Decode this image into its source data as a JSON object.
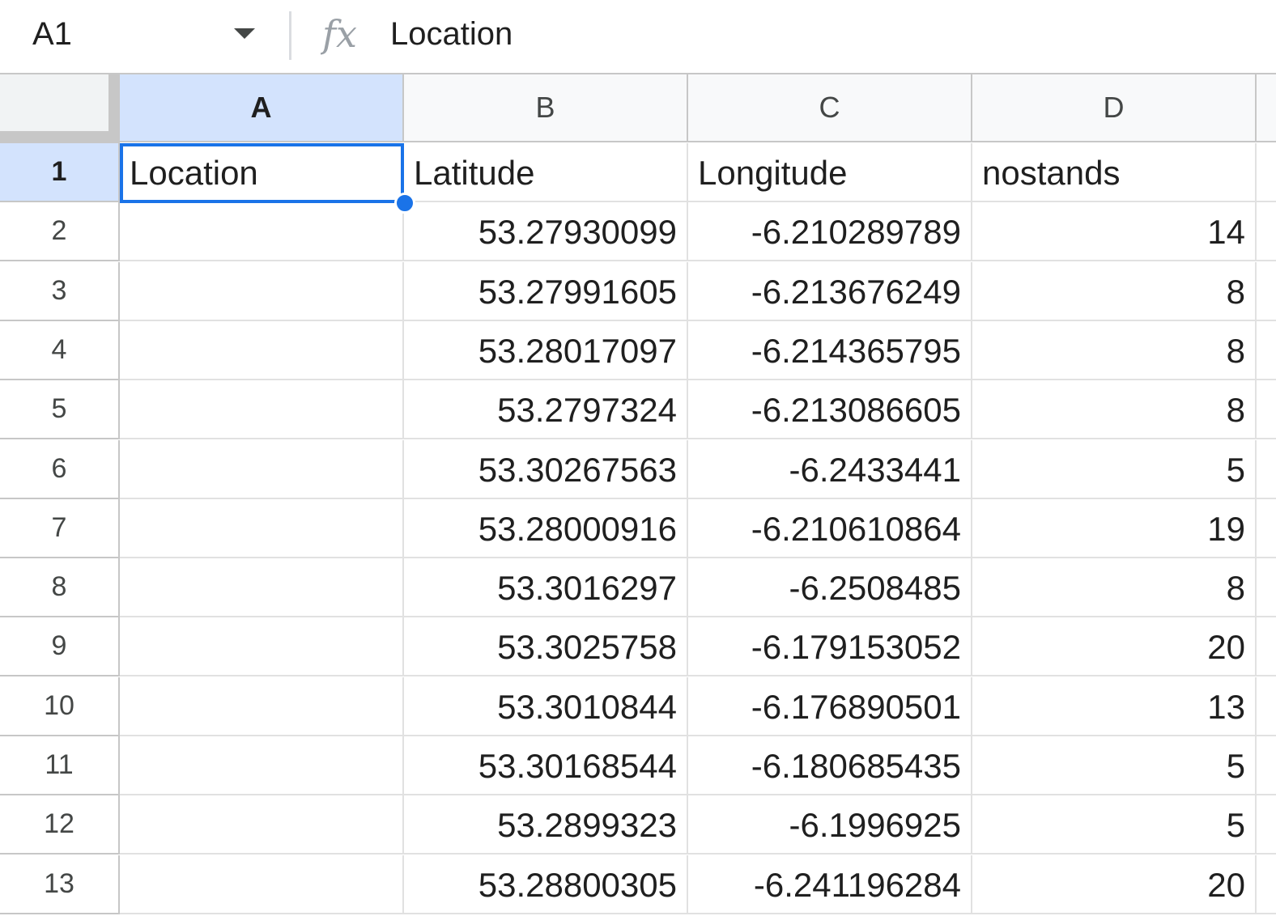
{
  "formula_bar": {
    "name_box": "A1",
    "fx_icon": "fx-icon",
    "content": "Location"
  },
  "columns": [
    "A",
    "B",
    "C",
    "D"
  ],
  "selected_column": "A",
  "selected_row": "1",
  "rows": [
    {
      "num": "1",
      "cells": [
        "Location",
        "Latitude",
        "Longitude",
        "nostands"
      ]
    },
    {
      "num": "2",
      "cells": [
        "",
        "53.27930099",
        "-6.210289789",
        "14"
      ]
    },
    {
      "num": "3",
      "cells": [
        "",
        "53.27991605",
        "-6.213676249",
        "8"
      ]
    },
    {
      "num": "4",
      "cells": [
        "",
        "53.28017097",
        "-6.214365795",
        "8"
      ]
    },
    {
      "num": "5",
      "cells": [
        "",
        "53.2797324",
        "-6.213086605",
        "8"
      ]
    },
    {
      "num": "6",
      "cells": [
        "",
        "53.30267563",
        "-6.2433441",
        "5"
      ]
    },
    {
      "num": "7",
      "cells": [
        "",
        "53.28000916",
        "-6.210610864",
        "19"
      ]
    },
    {
      "num": "8",
      "cells": [
        "",
        "53.3016297",
        "-6.2508485",
        "8"
      ]
    },
    {
      "num": "9",
      "cells": [
        "",
        "53.3025758",
        "-6.179153052",
        "20"
      ]
    },
    {
      "num": "10",
      "cells": [
        "",
        "53.3010844",
        "-6.176890501",
        "13"
      ]
    },
    {
      "num": "11",
      "cells": [
        "",
        "53.30168544",
        "-6.180685435",
        "5"
      ]
    },
    {
      "num": "12",
      "cells": [
        "",
        "53.2899323",
        "-6.1996925",
        "5"
      ]
    },
    {
      "num": "13",
      "cells": [
        "",
        "53.28800305",
        "-6.241196284",
        "20"
      ]
    }
  ]
}
